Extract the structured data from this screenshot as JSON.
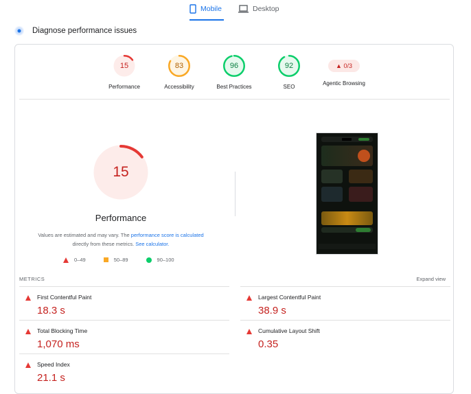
{
  "tabs": {
    "mobile": "Mobile",
    "desktop": "Desktop"
  },
  "header": {
    "title": "Diagnose performance issues"
  },
  "gauges": [
    {
      "score": "15",
      "label": "Performance",
      "value": 15,
      "color": "#e53935",
      "bg": "#fdecea"
    },
    {
      "score": "83",
      "label": "Accessibility",
      "value": 83,
      "color": "#f9a825",
      "bg": "#fef5e3"
    },
    {
      "score": "96",
      "label": "Best Practices",
      "value": 96,
      "color": "#0cce6b",
      "bg": "#e6f9ee"
    },
    {
      "score": "92",
      "label": "SEO",
      "value": 92,
      "color": "#0cce6b",
      "bg": "#e6f9ee"
    }
  ],
  "agentic": {
    "label": "Agentic Browsing",
    "pill": "▲ 0/3"
  },
  "summary": {
    "score": "15",
    "value": 15,
    "title": "Performance",
    "note_prefix": "Values are estimated and may vary. The ",
    "note_link1": "performance score is calculated",
    "note_mid": " directly from these metrics. ",
    "note_link2": "See calculator."
  },
  "legend": {
    "low": "0–49",
    "mid": "50–89",
    "high": "90–100"
  },
  "metrics_header": {
    "title": "METRICS",
    "expand": "Expand view"
  },
  "metrics": [
    {
      "name": "First Contentful Paint",
      "value": "18.3 s"
    },
    {
      "name": "Largest Contentful Paint",
      "value": "38.9 s"
    },
    {
      "name": "Total Blocking Time",
      "value": "1,070 ms"
    },
    {
      "name": "Cumulative Layout Shift",
      "value": "0.35"
    },
    {
      "name": "Speed Index",
      "value": "21.1 s"
    }
  ],
  "colors": {
    "accent": "#1a73e8",
    "fail": "#e53935",
    "average": "#f9a825",
    "pass": "#0cce6b"
  }
}
